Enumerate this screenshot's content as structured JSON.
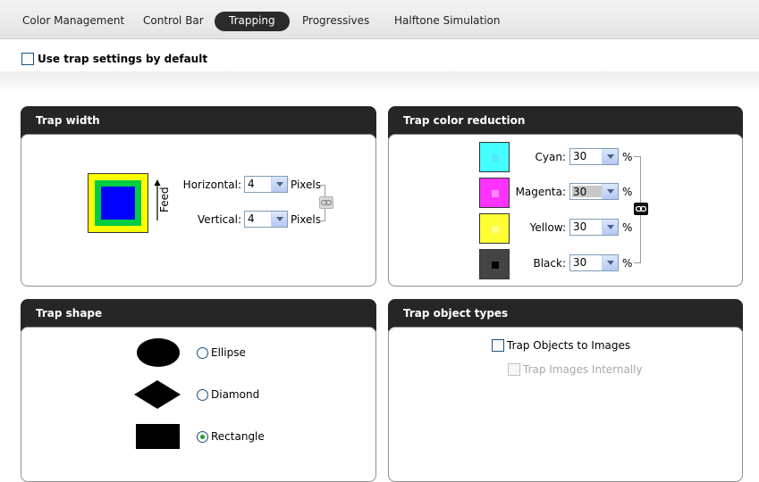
{
  "tabs": [
    {
      "label": "Color Management",
      "active": false
    },
    {
      "label": "Control Bar",
      "active": false
    },
    {
      "label": "Trapping",
      "active": true
    },
    {
      "label": "Progressives",
      "active": false
    },
    {
      "label": "Halftone Simulation",
      "active": false
    }
  ],
  "default_checkbox": {
    "label": "Use trap settings by default",
    "checked": false
  },
  "trap_width": {
    "title": "Trap width",
    "feed_label": "Feed",
    "horizontal": {
      "label": "Horizontal:",
      "value": "4",
      "unit": "Pixels"
    },
    "vertical": {
      "label": "Vertical:",
      "value": "4",
      "unit": "Pixels"
    },
    "link_icon": "chain-link-icon",
    "preview_colors": {
      "outer": "#ffff00",
      "middle": "#00cc44",
      "inner": "#0000ff"
    }
  },
  "trap_color_reduction": {
    "title": "Trap color reduction",
    "unit": "%",
    "link_icon": "chain-link-icon",
    "rows": [
      {
        "label": "Cyan:",
        "value": "30",
        "color": "#44ffff",
        "dot": "#55e5ff"
      },
      {
        "label": "Magenta:",
        "value": "30",
        "color": "#ff33ff",
        "dot": "#ff88ff",
        "selected": true
      },
      {
        "label": "Yellow:",
        "value": "30",
        "color": "#ffff33",
        "dot": "#ffff88"
      },
      {
        "label": "Black:",
        "value": "30",
        "color": "#444444",
        "dot": "#000000"
      }
    ]
  },
  "trap_shape": {
    "title": "Trap shape",
    "options": [
      {
        "label": "Ellipse",
        "selected": false
      },
      {
        "label": "Diamond",
        "selected": false
      },
      {
        "label": "Rectangle",
        "selected": true
      }
    ]
  },
  "trap_object_types": {
    "title": "Trap object types",
    "objects_to_images": {
      "label": "Trap Objects to Images",
      "checked": false
    },
    "images_internally": {
      "label": "Trap Images Internally",
      "checked": false,
      "enabled": false
    }
  }
}
